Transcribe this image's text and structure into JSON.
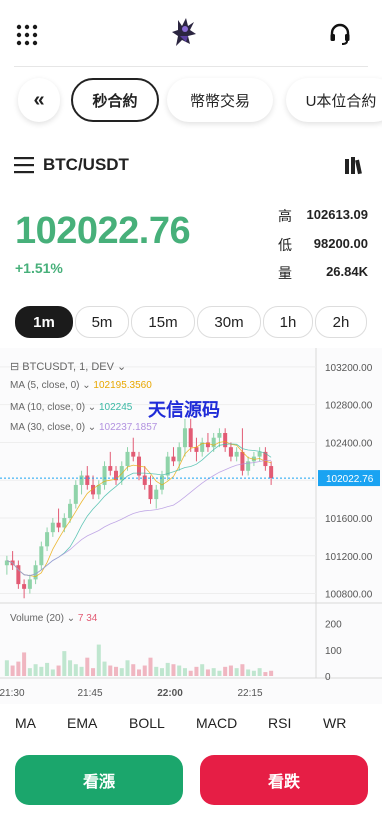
{
  "header": {
    "menu_icon": "grid-icon",
    "logo": "avatar-logo",
    "support_icon": "headset-icon"
  },
  "tabs": [
    {
      "label": "«"
    },
    {
      "label": "秒合約",
      "active": true
    },
    {
      "label": "幣幣交易"
    },
    {
      "label": "U本位合約"
    }
  ],
  "pair": "BTC/USDT",
  "price": "102022.76",
  "change": "+1.51%",
  "stats": [
    {
      "label": "高",
      "value": "102613.09"
    },
    {
      "label": "低",
      "value": "98200.00"
    },
    {
      "label": "量",
      "value": "26.84K"
    }
  ],
  "timeframes": [
    {
      "label": "1m",
      "active": true
    },
    {
      "label": "5m"
    },
    {
      "label": "15m"
    },
    {
      "label": "30m"
    },
    {
      "label": "1h"
    },
    {
      "label": "2h"
    }
  ],
  "chart": {
    "symbol_line": "BTCUSDT, 1, DEV",
    "ma5_label": "MA (5, close, 0)",
    "ma5_value": "102195.3560",
    "ma10_label": "MA (10, close, 0)",
    "ma10_value": "102245",
    "ma30_label": "MA (30, close, 0)",
    "ma30_value": "102237.1857",
    "watermark": "天信源码",
    "volume_label": "Volume (20)",
    "volume_value": "7 34",
    "last_price_tag": "102022.76",
    "colors": {
      "up": "#8fd3a9",
      "down": "#e25b74",
      "ma5": "#e8a700",
      "ma10": "#3bb9a5",
      "ma30": "#b292e0",
      "tag": "#1aa3f2"
    }
  },
  "chart_data": {
    "type": "candlestick",
    "y_ticks": [
      "103200.00",
      "102800.00",
      "102400.00",
      "102000.00",
      "101600.00",
      "101200.00",
      "100800.00"
    ],
    "volume_ticks": [
      "200",
      "100",
      "0"
    ],
    "x_ticks": [
      "21:30",
      "21:45",
      "22:00",
      "22:15"
    ],
    "ylim": [
      100700,
      103400
    ],
    "candles": [
      [
        101100,
        101200,
        101000,
        101150
      ],
      [
        101150,
        101250,
        101050,
        101100
      ],
      [
        101100,
        101150,
        100850,
        100900
      ],
      [
        100900,
        100950,
        100750,
        100850
      ],
      [
        100850,
        101000,
        100800,
        100950
      ],
      [
        100950,
        101150,
        100900,
        101100
      ],
      [
        101100,
        101350,
        101050,
        101300
      ],
      [
        101300,
        101500,
        101250,
        101450
      ],
      [
        101450,
        101600,
        101400,
        101550
      ],
      [
        101550,
        101700,
        101450,
        101500
      ],
      [
        101500,
        101650,
        101450,
        101600
      ],
      [
        101600,
        101800,
        101550,
        101750
      ],
      [
        101750,
        102000,
        101700,
        101950
      ],
      [
        101950,
        102100,
        101850,
        102050
      ],
      [
        102050,
        102150,
        101900,
        101950
      ],
      [
        101950,
        102050,
        101800,
        101850
      ],
      [
        101850,
        102000,
        101800,
        101950
      ],
      [
        101950,
        102200,
        101900,
        102150
      ],
      [
        102150,
        102300,
        102050,
        102100
      ],
      [
        102100,
        102150,
        101950,
        102000
      ],
      [
        102000,
        102200,
        101950,
        102150
      ],
      [
        102150,
        102350,
        102100,
        102300
      ],
      [
        102300,
        102450,
        102200,
        102250
      ],
      [
        102250,
        102300,
        102000,
        102050
      ],
      [
        102050,
        102150,
        101900,
        101950
      ],
      [
        101950,
        102050,
        101750,
        101800
      ],
      [
        101800,
        101950,
        101700,
        101900
      ],
      [
        101900,
        102100,
        101850,
        102050
      ],
      [
        102050,
        102300,
        102000,
        102250
      ],
      [
        102250,
        102350,
        102150,
        102200
      ],
      [
        102200,
        102400,
        102100,
        102350
      ],
      [
        102350,
        102650,
        102250,
        102550
      ],
      [
        102550,
        102650,
        102300,
        102350
      ],
      [
        102350,
        102450,
        102200,
        102300
      ],
      [
        102300,
        102450,
        102250,
        102400
      ],
      [
        102400,
        102500,
        102300,
        102350
      ],
      [
        102350,
        102500,
        102300,
        102450
      ],
      [
        102450,
        102550,
        102350,
        102500
      ],
      [
        102500,
        102550,
        102300,
        102350
      ],
      [
        102350,
        102400,
        102200,
        102250
      ],
      [
        102250,
        102350,
        102200,
        102300
      ],
      [
        102300,
        102550,
        102050,
        102100
      ],
      [
        102100,
        102250,
        102050,
        102200
      ],
      [
        102200,
        102300,
        102150,
        102250
      ],
      [
        102250,
        102350,
        102200,
        102300
      ],
      [
        102300,
        102350,
        102100,
        102150
      ],
      [
        102150,
        102200,
        101950,
        102022.76
      ]
    ],
    "volume": [
      60,
      40,
      55,
      90,
      30,
      45,
      35,
      50,
      25,
      40,
      95,
      60,
      45,
      35,
      70,
      30,
      120,
      55,
      40,
      35,
      30,
      60,
      45,
      25,
      40,
      70,
      35,
      30,
      50,
      45,
      40,
      30,
      20,
      35,
      45,
      25,
      30,
      20,
      35,
      40,
      30,
      45,
      25,
      20,
      30,
      15,
      20
    ]
  },
  "indicators": [
    "MA",
    "EMA",
    "BOLL",
    "MACD",
    "RSI",
    "WR"
  ],
  "actions": {
    "buy": "看漲",
    "sell": "看跌"
  }
}
